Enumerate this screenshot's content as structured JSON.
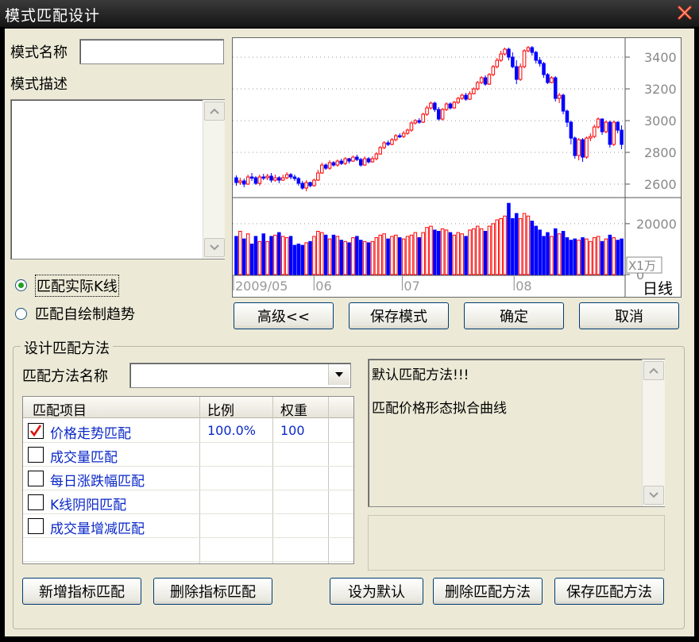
{
  "window": {
    "title": "模式匹配设计"
  },
  "pattern": {
    "name_label": "模式名称",
    "name_value": "",
    "desc_label": "模式描述",
    "desc_value": ""
  },
  "source": {
    "options": [
      "匹配实际K线",
      "匹配自绘制趋势"
    ],
    "selected": 0
  },
  "chart": {
    "price_ticks": [
      "3400",
      "3200",
      "3000",
      "2800",
      "2600"
    ],
    "volume_ticks": [
      "20000",
      "0"
    ],
    "volume_unit": "X1万",
    "date_labels": [
      "2009/05",
      "06",
      "07",
      "08"
    ],
    "period": "日线",
    "colors": {
      "up": "#ff0000",
      "down": "#0000ff"
    }
  },
  "chart_data": {
    "type": "candlestick",
    "ylim": [
      2520,
      3500
    ],
    "volume_ylim": [
      0,
      29000
    ],
    "candles": [
      [
        2640,
        2610,
        2590,
        2655,
        15000
      ],
      [
        2610,
        2620,
        2595,
        2640,
        17000
      ],
      [
        2620,
        2600,
        2580,
        2635,
        14000
      ],
      [
        2600,
        2645,
        2595,
        2660,
        16000
      ],
      [
        2645,
        2640,
        2620,
        2670,
        12000
      ],
      [
        2640,
        2605,
        2595,
        2650,
        15000
      ],
      [
        2605,
        2645,
        2590,
        2660,
        13000
      ],
      [
        2645,
        2640,
        2625,
        2665,
        16000
      ],
      [
        2640,
        2650,
        2625,
        2665,
        13000
      ],
      [
        2650,
        2625,
        2610,
        2670,
        15000
      ],
      [
        2625,
        2640,
        2615,
        2660,
        15500
      ],
      [
        2640,
        2625,
        2605,
        2650,
        16500
      ],
      [
        2625,
        2640,
        2620,
        2660,
        15000
      ],
      [
        2640,
        2660,
        2630,
        2675,
        14500
      ],
      [
        2660,
        2645,
        2630,
        2670,
        15000
      ],
      [
        2645,
        2635,
        2620,
        2660,
        11500
      ],
      [
        2635,
        2605,
        2590,
        2645,
        12000
      ],
      [
        2605,
        2575,
        2565,
        2620,
        11500
      ],
      [
        2575,
        2610,
        2555,
        2625,
        12500
      ],
      [
        2610,
        2590,
        2580,
        2615,
        13000
      ],
      [
        2590,
        2625,
        2585,
        2635,
        15000
      ],
      [
        2625,
        2670,
        2620,
        2690,
        17000
      ],
      [
        2670,
        2720,
        2665,
        2735,
        16500
      ],
      [
        2720,
        2700,
        2690,
        2730,
        15500
      ],
      [
        2700,
        2735,
        2690,
        2750,
        14000
      ],
      [
        2735,
        2720,
        2710,
        2745,
        15500
      ],
      [
        2720,
        2745,
        2710,
        2755,
        15000
      ],
      [
        2745,
        2730,
        2720,
        2760,
        13500
      ],
      [
        2730,
        2760,
        2720,
        2770,
        13000
      ],
      [
        2760,
        2745,
        2730,
        2765,
        12500
      ],
      [
        2745,
        2770,
        2740,
        2780,
        14500
      ],
      [
        2770,
        2755,
        2745,
        2785,
        15000
      ],
      [
        2755,
        2720,
        2710,
        2765,
        13500
      ],
      [
        2720,
        2760,
        2715,
        2775,
        13000
      ],
      [
        2760,
        2740,
        2730,
        2770,
        12500
      ],
      [
        2740,
        2760,
        2735,
        2775,
        13000
      ],
      [
        2760,
        2790,
        2750,
        2800,
        14500
      ],
      [
        2790,
        2830,
        2785,
        2840,
        15500
      ],
      [
        2830,
        2860,
        2820,
        2870,
        16000
      ],
      [
        2860,
        2850,
        2840,
        2875,
        14000
      ],
      [
        2850,
        2880,
        2845,
        2890,
        15000
      ],
      [
        2880,
        2905,
        2870,
        2915,
        15500
      ],
      [
        2905,
        2900,
        2890,
        2920,
        14500
      ],
      [
        2900,
        2920,
        2890,
        2935,
        14000
      ],
      [
        2920,
        2940,
        2910,
        2950,
        15000
      ],
      [
        2940,
        2985,
        2930,
        2995,
        15500
      ],
      [
        2985,
        3000,
        2975,
        3010,
        16500
      ],
      [
        3000,
        2990,
        2980,
        3015,
        14500
      ],
      [
        2990,
        3040,
        2985,
        3050,
        16500
      ],
      [
        3040,
        3080,
        3030,
        3095,
        18500
      ],
      [
        3080,
        3110,
        3070,
        3120,
        19000
      ],
      [
        3110,
        3070,
        3055,
        3120,
        17500
      ],
      [
        3070,
        3010,
        3000,
        3085,
        17000
      ],
      [
        3010,
        3070,
        3000,
        3080,
        18000
      ],
      [
        3070,
        3105,
        3060,
        3115,
        17500
      ],
      [
        3105,
        3080,
        3070,
        3115,
        16500
      ],
      [
        3080,
        3115,
        3075,
        3125,
        15500
      ],
      [
        3115,
        3140,
        3105,
        3150,
        16500
      ],
      [
        3140,
        3160,
        3130,
        3170,
        16000
      ],
      [
        3160,
        3135,
        3125,
        3175,
        15000
      ],
      [
        3135,
        3170,
        3130,
        3185,
        17500
      ],
      [
        3170,
        3200,
        3165,
        3210,
        18000
      ],
      [
        3200,
        3240,
        3190,
        3250,
        19000
      ],
      [
        3240,
        3270,
        3230,
        3280,
        18000
      ],
      [
        3270,
        3230,
        3220,
        3285,
        17000
      ],
      [
        3230,
        3290,
        3225,
        3300,
        19000
      ],
      [
        3290,
        3340,
        3280,
        3350,
        20000
      ],
      [
        3340,
        3380,
        3330,
        3395,
        21500
      ],
      [
        3380,
        3420,
        3370,
        3440,
        22000
      ],
      [
        3420,
        3450,
        3410,
        3460,
        23000
      ],
      [
        3450,
        3400,
        3380,
        3460,
        28000
      ],
      [
        3400,
        3340,
        3330,
        3430,
        22000
      ],
      [
        3340,
        3260,
        3230,
        3380,
        24000
      ],
      [
        3260,
        3340,
        3250,
        3360,
        22000
      ],
      [
        3340,
        3440,
        3330,
        3450,
        24000
      ],
      [
        3440,
        3460,
        3430,
        3470,
        23000
      ],
      [
        3460,
        3430,
        3410,
        3470,
        21000
      ],
      [
        3430,
        3380,
        3360,
        3440,
        19000
      ],
      [
        3380,
        3360,
        3340,
        3400,
        17500
      ],
      [
        3360,
        3290,
        3270,
        3370,
        15000
      ],
      [
        3290,
        3240,
        3230,
        3300,
        16500
      ],
      [
        3240,
        3270,
        3235,
        3280,
        15000
      ],
      [
        3270,
        3140,
        3120,
        3280,
        18000
      ],
      [
        3140,
        3160,
        3110,
        3175,
        16000
      ],
      [
        3160,
        3060,
        3040,
        3170,
        17000
      ],
      [
        3060,
        2990,
        2960,
        3070,
        14500
      ],
      [
        2990,
        2890,
        2850,
        3000,
        13500
      ],
      [
        2890,
        2780,
        2760,
        2900,
        14000
      ],
      [
        2780,
        2880,
        2750,
        2890,
        13500
      ],
      [
        2880,
        2770,
        2740,
        2890,
        14500
      ],
      [
        2770,
        2890,
        2760,
        2900,
        14000
      ],
      [
        2890,
        2900,
        2870,
        2920,
        13000
      ],
      [
        2900,
        2960,
        2890,
        2975,
        14500
      ],
      [
        2960,
        3010,
        2950,
        3020,
        15000
      ],
      [
        3010,
        2930,
        2910,
        3015,
        13000
      ],
      [
        2930,
        2990,
        2920,
        3000,
        14000
      ],
      [
        2990,
        2850,
        2830,
        3000,
        15500
      ],
      [
        2850,
        2990,
        2840,
        3000,
        14500
      ],
      [
        2990,
        2940,
        2920,
        2995,
        13500
      ],
      [
        2940,
        2850,
        2820,
        2970,
        14000
      ]
    ]
  },
  "actions": {
    "advanced": "高级<<",
    "save_pattern": "保存模式",
    "ok": "确定",
    "cancel": "取消"
  },
  "method": {
    "group_title": "设计匹配方法",
    "name_label": "匹配方法名称",
    "name_value": "",
    "columns": [
      "匹配项目",
      "比例",
      "权重"
    ],
    "rows": [
      {
        "label": "价格走势匹配",
        "checked": true,
        "ratio": "100.0%",
        "weight": "100"
      },
      {
        "label": "成交量匹配",
        "checked": false,
        "ratio": "",
        "weight": ""
      },
      {
        "label": "每日涨跌幅匹配",
        "checked": false,
        "ratio": "",
        "weight": ""
      },
      {
        "label": "K线阴阳匹配",
        "checked": false,
        "ratio": "",
        "weight": ""
      },
      {
        "label": "成交量增减匹配",
        "checked": false,
        "ratio": "",
        "weight": ""
      }
    ],
    "info_line1": "默认匹配方法!!!",
    "info_line2": "匹配价格形态拟合曲线"
  },
  "bottom_buttons": {
    "add": "新增指标匹配",
    "delete": "删除指标匹配",
    "set_default": "设为默认",
    "delete_method": "删除匹配方法",
    "save_method": "保存匹配方法"
  }
}
